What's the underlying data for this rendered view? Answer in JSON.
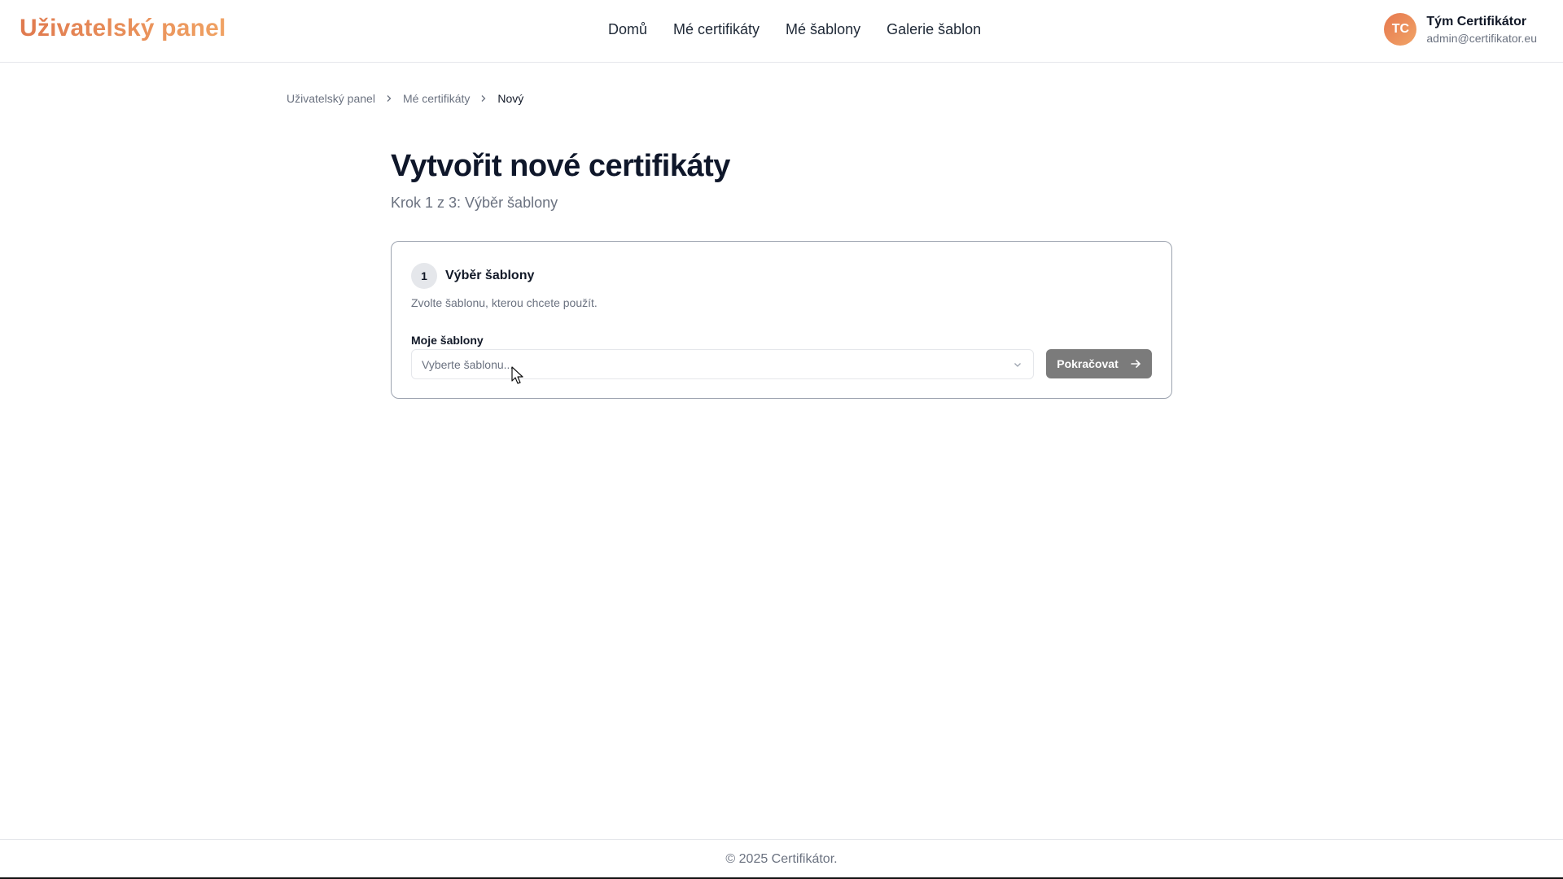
{
  "header": {
    "brand": "Uživatelský panel",
    "nav": [
      {
        "label": "Domů"
      },
      {
        "label": "Mé certifikáty"
      },
      {
        "label": "Mé šablony"
      },
      {
        "label": "Galerie šablon"
      }
    ],
    "user": {
      "initials": "TC",
      "name": "Tým Certifikátor",
      "email": "admin@certifikator.eu"
    }
  },
  "breadcrumb": {
    "items": [
      "Uživatelský panel",
      "Mé certifikáty",
      "Nový"
    ]
  },
  "page": {
    "title": "Vytvořit nové certifikáty",
    "subtitle": "Krok 1 z 3: Výběr šablony"
  },
  "card": {
    "step_number": "1",
    "step_title": "Výběr šablony",
    "description": "Zvolte šablonu, kterou chcete použít.",
    "field_label": "Moje šablony",
    "select_placeholder": "Vyberte šablonu...",
    "continue_label": "Pokračovat"
  },
  "footer": {
    "text": "© 2025 Certifikátor."
  },
  "colors": {
    "brand_start": "#e07a4f",
    "brand_end": "#f0a263",
    "button_bg": "#7b7b7b",
    "card_border": "#9ca3af"
  },
  "icons": {
    "breadcrumb_separator": "chevron-right-icon",
    "select_chevron": "chevron-down-icon",
    "button_icon": "arrow-right-icon"
  }
}
